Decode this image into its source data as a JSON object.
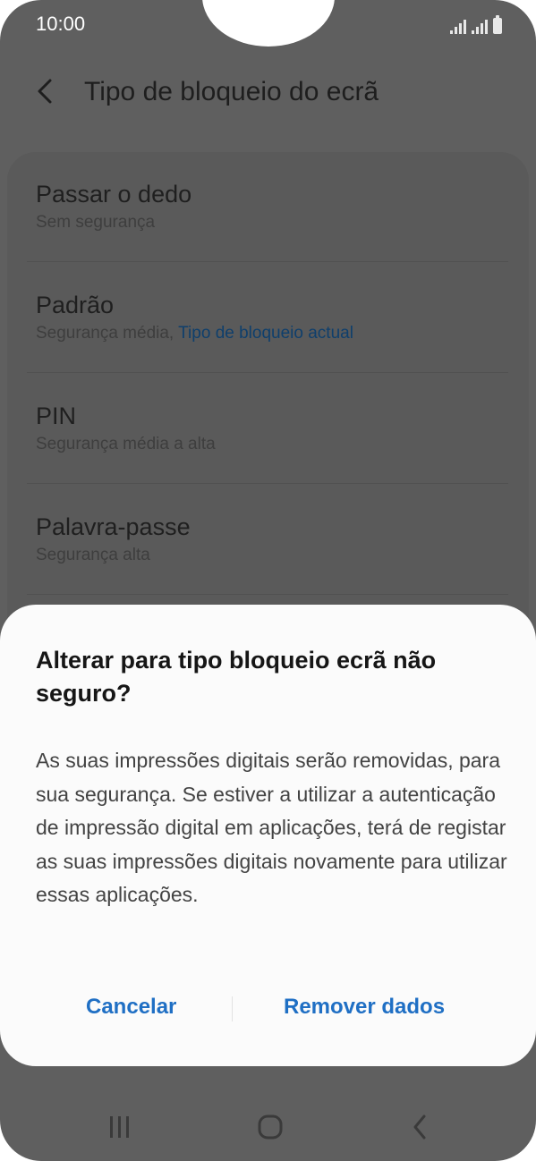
{
  "status_bar": {
    "time": "10:00",
    "icons": [
      "signal-icon",
      "signal-icon",
      "battery-icon"
    ]
  },
  "header": {
    "back_icon": "chevron-left-icon",
    "title": "Tipo de bloqueio do ecrã"
  },
  "lock_options": [
    {
      "label": "Passar o dedo",
      "subtitle": "Sem segurança",
      "subtitle_link": ""
    },
    {
      "label": "Padrão",
      "subtitle": "Segurança média, ",
      "subtitle_link": "Tipo de bloqueio actual"
    },
    {
      "label": "PIN",
      "subtitle": "Segurança média a alta",
      "subtitle_link": ""
    },
    {
      "label": "Palavra-passe",
      "subtitle": "Segurança alta",
      "subtitle_link": ""
    }
  ],
  "dialog": {
    "title": "Alterar para tipo bloqueio ecrã não seguro?",
    "body": "As suas impressões digitais serão removidas, para sua segurança. Se estiver a utilizar a autenticação de impressão digital em aplicações, terá de registar as suas impressões digitais novamente para utilizar essas aplicações.",
    "cancel_label": "Cancelar",
    "confirm_label": "Remover dados"
  },
  "colors": {
    "accent": "#1f6fc4",
    "link": "#0f3f6c",
    "dim_background": "#5f5f5f",
    "dialog_background": "#fbfbfb"
  },
  "nav_bar": {
    "icons": [
      "recent-apps-icon",
      "home-icon",
      "back-icon"
    ]
  }
}
